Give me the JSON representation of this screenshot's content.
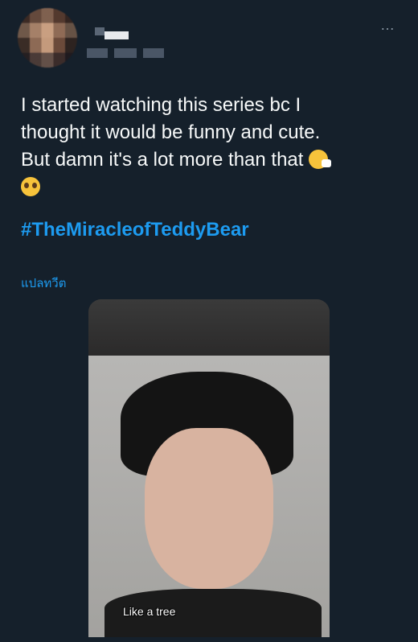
{
  "tweet": {
    "text_line1": "I started watching this series bc I",
    "text_line2": "thought it would be funny and cute.",
    "text_line3": "But damn it's a lot more than that",
    "hashtag": "#TheMiracleofTeddyBear",
    "translate_link": "แปลทวีต",
    "more_icon": "…",
    "emojis": [
      "sneezing-face",
      "pleading-face"
    ]
  },
  "media": {
    "subtitle": "Like a tree"
  },
  "colors": {
    "background": "#15202b",
    "text": "#f7f9f9",
    "link": "#1d9bf0",
    "muted": "#8b98a5"
  }
}
